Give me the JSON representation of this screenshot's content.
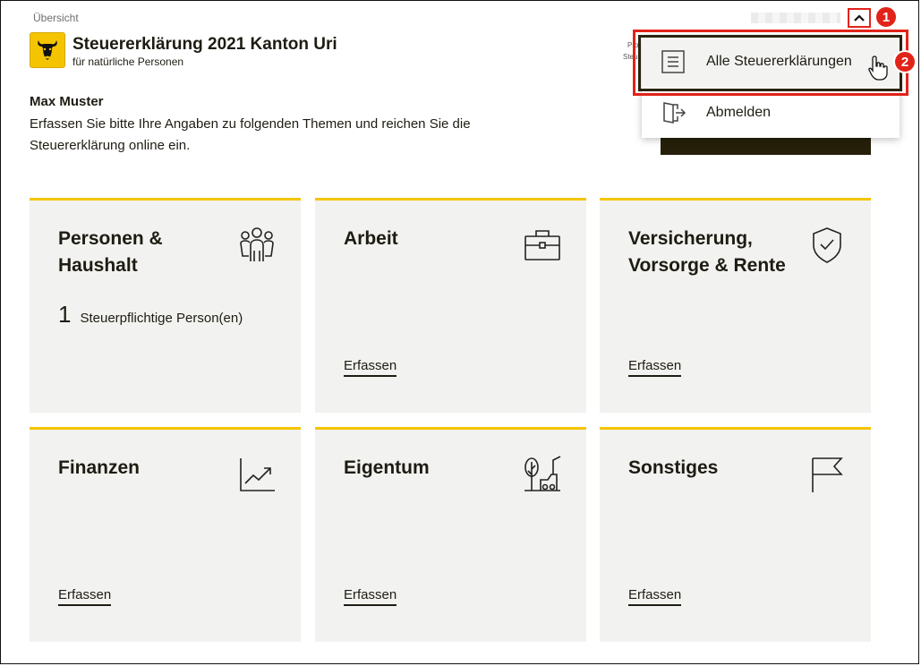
{
  "breadcrumb": "Übersicht",
  "header": {
    "title": "Steuererklärung 2021 Kanton Uri",
    "subtitle": "für natürliche Personen",
    "hidden_labels": [
      "Pro",
      "Steu"
    ]
  },
  "annotations": {
    "marker_1": "1",
    "marker_2": "2"
  },
  "menu": {
    "items": [
      {
        "label": "Alle Steuererklärungen",
        "icon": "list-icon"
      },
      {
        "label": "Abmelden",
        "icon": "logout-icon"
      }
    ]
  },
  "intro": {
    "name": "Max Muster",
    "text": "Erfassen Sie bitte Ihre Angaben zu folgenden Themen und reichen Sie die Steuererklärung online ein."
  },
  "tiles": [
    {
      "title": "Personen & Haushalt",
      "icon": "people-icon",
      "count": "1",
      "count_label": "Steuerpflichtige Person(en)"
    },
    {
      "title": "Arbeit",
      "icon": "briefcase-icon",
      "action": "Erfassen"
    },
    {
      "title": "Versicherung, Vorsorge & Rente",
      "icon": "shield-check-icon",
      "action": "Erfassen"
    },
    {
      "title": "Finanzen",
      "icon": "chart-icon",
      "action": "Erfassen"
    },
    {
      "title": "Eigentum",
      "icon": "property-icon",
      "action": "Erfassen"
    },
    {
      "title": "Sonstiges",
      "icon": "flag-icon",
      "action": "Erfassen"
    }
  ],
  "colors": {
    "accent": "#f5c400",
    "tile_bg": "#f2f2f0",
    "dark": "#26200a",
    "annotation": "#e2231a"
  }
}
